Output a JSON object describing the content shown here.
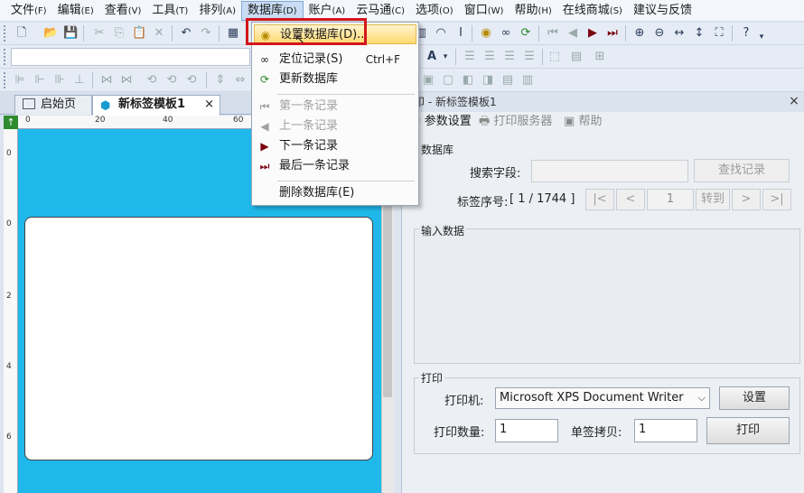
{
  "menubar": {
    "items": [
      {
        "label": "文件",
        "acc": "(F)"
      },
      {
        "label": "编辑",
        "acc": "(E)"
      },
      {
        "label": "查看",
        "acc": "(V)"
      },
      {
        "label": "工具",
        "acc": "(T)"
      },
      {
        "label": "排列",
        "acc": "(A)"
      },
      {
        "label": "数据库",
        "acc": "(D)"
      },
      {
        "label": "账户",
        "acc": "(A)"
      },
      {
        "label": "云马通",
        "acc": "(C)"
      },
      {
        "label": "选项",
        "acc": "(O)"
      },
      {
        "label": "窗口",
        "acc": "(W)"
      },
      {
        "label": "帮助",
        "acc": "(H)"
      },
      {
        "label": "在线商城",
        "acc": "(S)"
      },
      {
        "label": "建议与反馈",
        "acc": ""
      }
    ]
  },
  "database_menu": {
    "items": [
      {
        "label": "设置数据库(D)...",
        "shortcut": "",
        "icon": "database-settings-icon"
      },
      {
        "label": "定位记录(S)",
        "shortcut": "Ctrl+F",
        "icon": "binoculars-icon"
      },
      {
        "label": "更新数据库",
        "shortcut": "",
        "icon": "refresh-icon"
      },
      {
        "label": "第一条记录",
        "shortcut": "",
        "icon": "first-record-icon"
      },
      {
        "label": "上一条记录",
        "shortcut": "",
        "icon": "previous-record-icon"
      },
      {
        "label": "下一条记录",
        "shortcut": "",
        "icon": "next-record-icon"
      },
      {
        "label": "最后一条记录",
        "shortcut": "",
        "icon": "last-record-icon"
      },
      {
        "label": "删除数据库(E)",
        "shortcut": "",
        "icon": ""
      }
    ]
  },
  "tabs": {
    "home": "启始页",
    "template": "新标签模板1",
    "close": "×"
  },
  "ruler": {
    "top": [
      "0",
      "20",
      "40",
      "60"
    ],
    "left": [
      "0",
      "2",
      "4",
      "6"
    ]
  },
  "panel": {
    "title": "印 - 新标签模板1",
    "close": "×",
    "toolbar": {
      "params": "参数设置",
      "print_server": "打印服务器",
      "help": "帮助"
    },
    "database": {
      "title": "数据库",
      "search_label": "搜索字段:",
      "search_value": "",
      "find_button": "查找记录",
      "serial_label": "标签序号:",
      "serial_value": "[ 1 / 1744 ]",
      "nav_first": "|<",
      "nav_prev": "<",
      "record_value": "1",
      "goto": "转到",
      "nav_next": ">",
      "nav_last": ">|"
    },
    "input_data": {
      "title": "输入数据"
    },
    "print": {
      "title": "打印",
      "printer_label": "打印机:",
      "printer_value": "Microsoft XPS Document Writer",
      "settings_button": "设置",
      "qty_label": "打印数量:",
      "qty_value": "1",
      "copies_label": "单签拷贝:",
      "copies_value": "1",
      "print_button": "打印"
    }
  }
}
